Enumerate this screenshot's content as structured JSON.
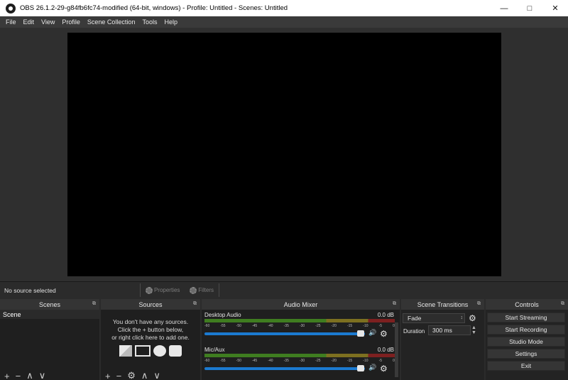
{
  "window": {
    "title": "OBS 26.1.2-29-g84fb6fc74-modified (64-bit, windows) - Profile: Untitled - Scenes: Untitled",
    "minimize_icon": "minimize-icon",
    "maximize_icon": "maximize-icon",
    "close_icon": "close-icon"
  },
  "menu": [
    "File",
    "Edit",
    "View",
    "Profile",
    "Scene Collection",
    "Tools",
    "Help"
  ],
  "status": {
    "no_source": "No source selected",
    "properties_label": "Properties",
    "filters_label": "Filters"
  },
  "scenes": {
    "title": "Scenes",
    "items": [
      "Scene"
    ]
  },
  "sources": {
    "title": "Sources",
    "empty_line1": "You don't have any sources.",
    "empty_line2": "Click the + button below,",
    "empty_line3": "or right click here to add one."
  },
  "mixer": {
    "title": "Audio Mixer",
    "ticks": [
      "-60",
      "-55",
      "-50",
      "-45",
      "-40",
      "-35",
      "-30",
      "-25",
      "-20",
      "-15",
      "-10",
      "-5",
      "0"
    ],
    "channels": [
      {
        "name": "Desktop Audio",
        "db": "0.0 dB"
      },
      {
        "name": "Mic/Aux",
        "db": "0.0 dB"
      }
    ]
  },
  "transitions": {
    "title": "Scene Transitions",
    "selected": "Fade",
    "duration_label": "Duration",
    "duration_value": "300 ms"
  },
  "controls": {
    "title": "Controls",
    "start_streaming": "Start Streaming",
    "start_recording": "Start Recording",
    "studio_mode": "Studio Mode",
    "settings": "Settings",
    "exit": "Exit"
  },
  "colors": {
    "accent": "#1b7ad0",
    "meter_green": "#4fcf2a",
    "meter_yellow": "#b9a629",
    "meter_red": "#c83030"
  }
}
